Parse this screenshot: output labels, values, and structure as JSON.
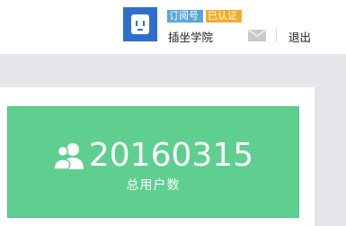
{
  "header": {
    "account_badges": [
      "订阅号",
      "已认证"
    ],
    "account_name": "插坐学院",
    "logout_label": "退出",
    "mail_icon": "mail-icon",
    "avatar_icon": "socket-logo"
  },
  "stat_card": {
    "value": "20160315",
    "label": "总用户数",
    "icon": "users-icon"
  },
  "colors": {
    "logo": "#2f6fcb",
    "badge_subscription": "#58a6d6",
    "badge_verified": "#f0ad2b",
    "stat_card": "#5ecf8f",
    "background": "#e6e7ea"
  }
}
